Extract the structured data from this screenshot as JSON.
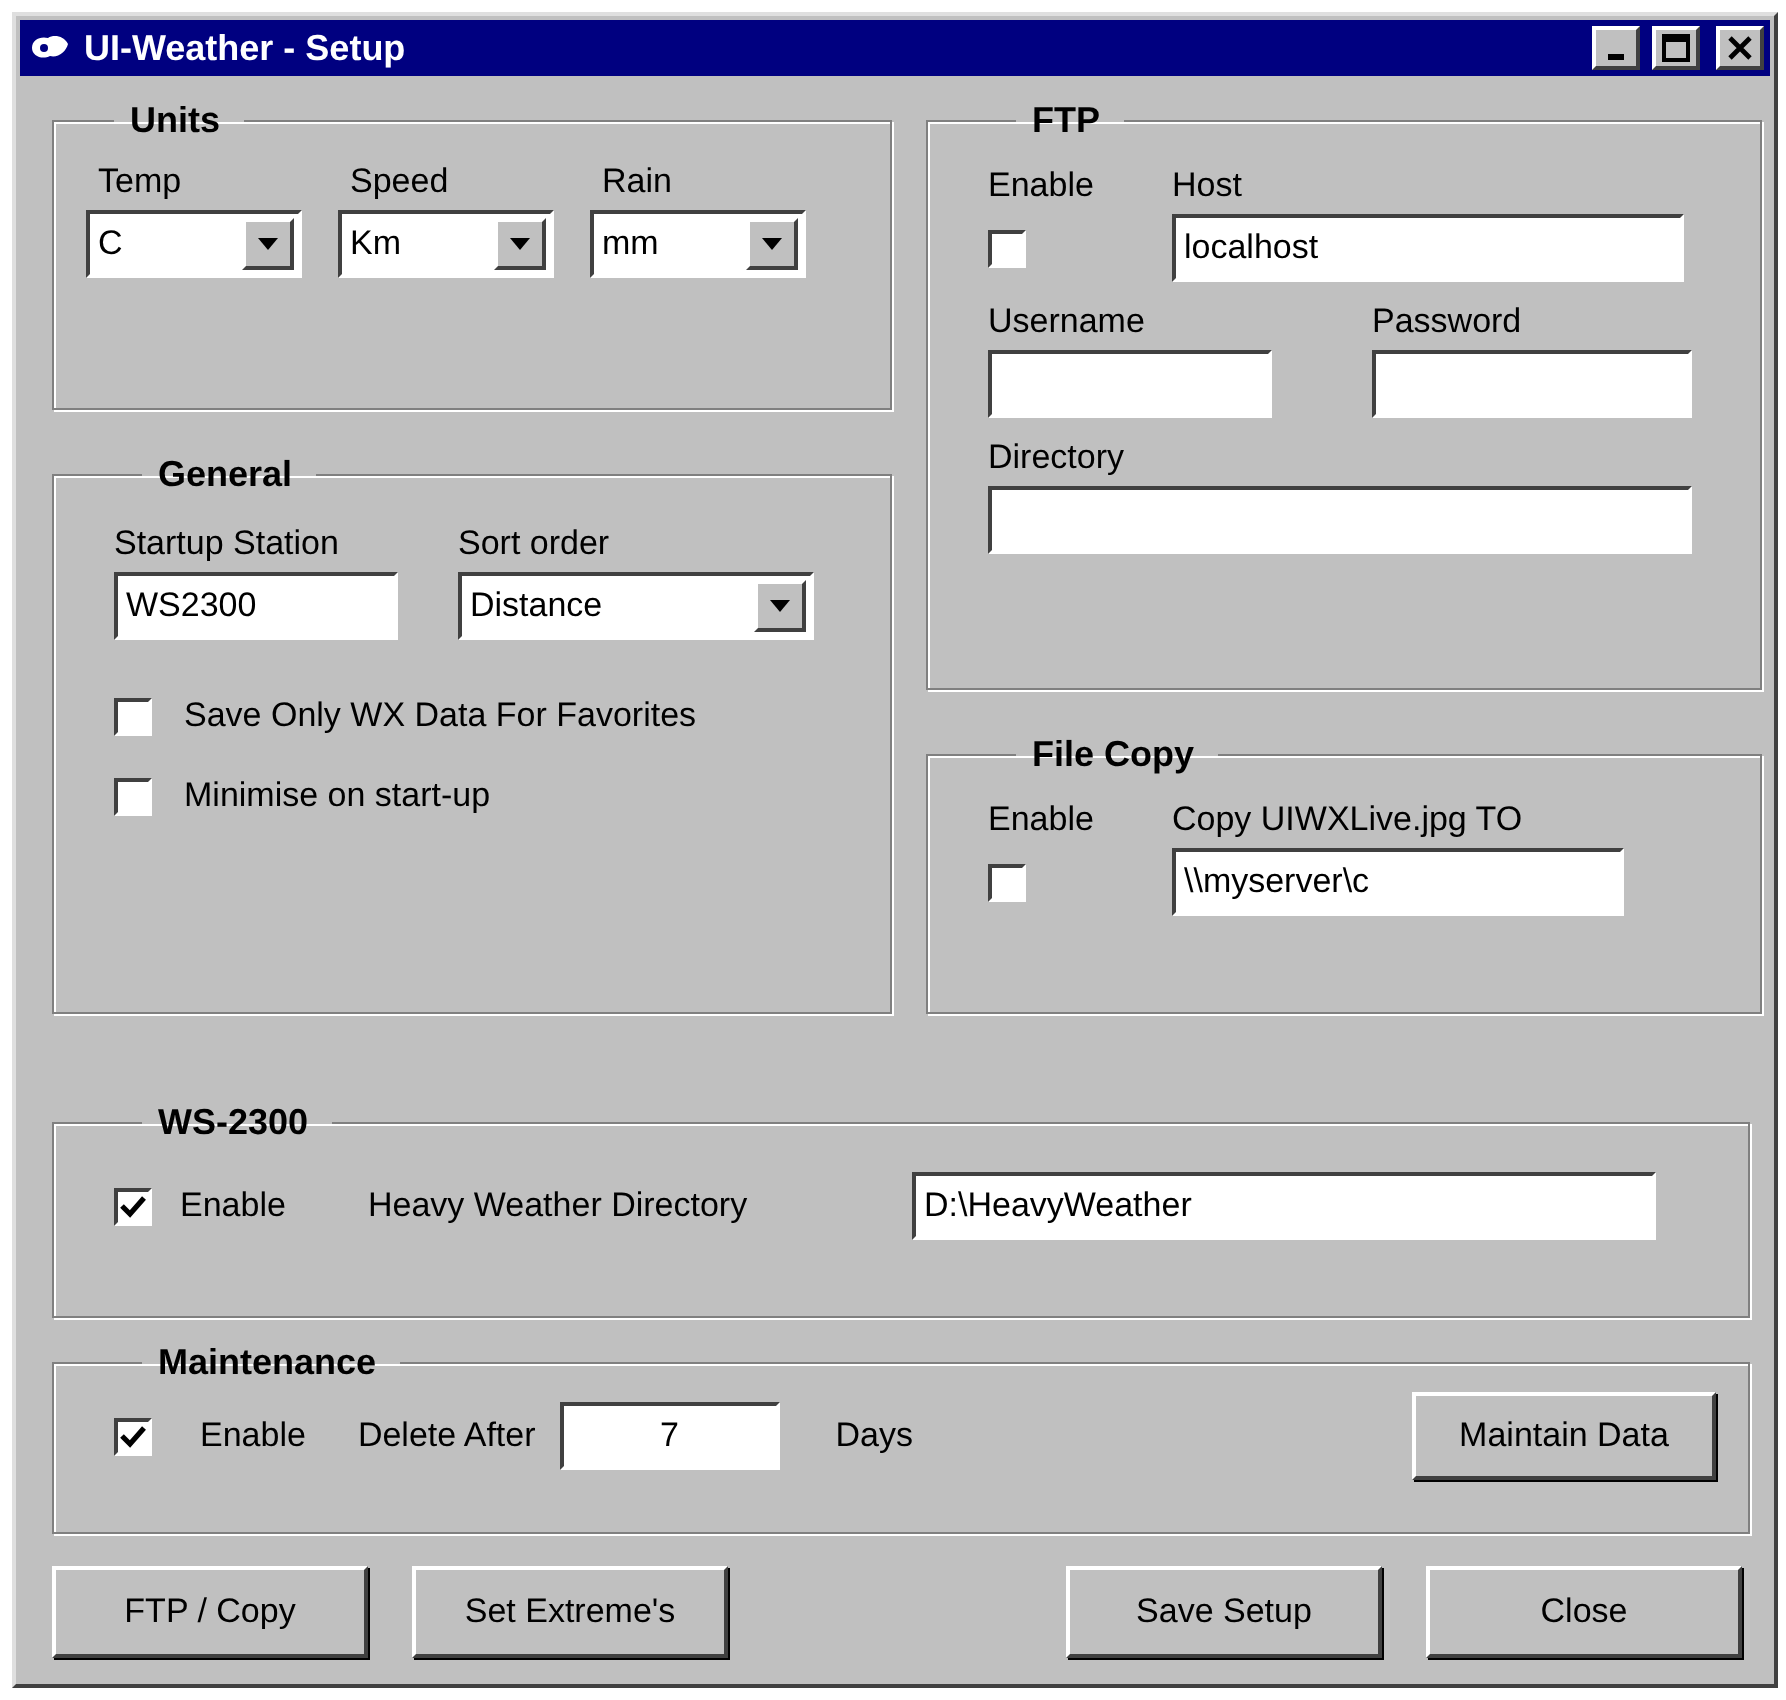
{
  "window": {
    "title": "UI-Weather - Setup"
  },
  "units": {
    "title": "Units",
    "fields": [
      {
        "label": "Temp",
        "value": "C"
      },
      {
        "label": "Speed",
        "value": "Km"
      },
      {
        "label": "Rain",
        "value": "mm"
      }
    ]
  },
  "general": {
    "title": "General",
    "startup_station": {
      "label": "Startup Station",
      "value": "WS2300"
    },
    "sort_order": {
      "label": "Sort order",
      "value": "Distance"
    },
    "options": [
      {
        "label": "Save Only WX Data For Favorites",
        "checked": false
      },
      {
        "label": "Minimise on start-up",
        "checked": false
      }
    ]
  },
  "ftp": {
    "title": "FTP",
    "enable": {
      "label": "Enable",
      "checked": false
    },
    "host": {
      "label": "Host",
      "value": "localhost"
    },
    "username": {
      "label": "Username"
    },
    "password": {
      "label": "Password"
    },
    "directory": {
      "label": "Directory"
    }
  },
  "file_copy": {
    "title": "File Copy",
    "enable": {
      "label": "Enable",
      "checked": false
    },
    "destination": {
      "label": "Copy UIWXLive.jpg TO",
      "value": "\\\\myserver\\c"
    }
  },
  "ws2300": {
    "title": "WS-2300",
    "enable": {
      "label": "Enable",
      "checked": true
    },
    "directory": {
      "label": "Heavy Weather Directory",
      "value": "D:\\HeavyWeather"
    }
  },
  "maintenance": {
    "title": "Maintenance",
    "enable": {
      "label": "Enable",
      "checked": true
    },
    "delete_after": {
      "label": "Delete After",
      "value": "7",
      "unit": "Days"
    },
    "button": "Maintain Data"
  },
  "buttons": [
    "FTP / Copy",
    "Set Extreme's",
    "Save Setup",
    "Close"
  ]
}
